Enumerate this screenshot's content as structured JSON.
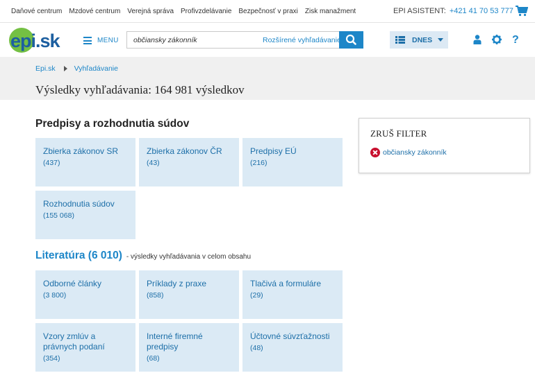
{
  "topnav": [
    "Daňové centrum",
    "Mzdové centrum",
    "Verejná správa",
    "Profivzdelávanie",
    "Bezpečnosť v praxi",
    "Zisk manažment"
  ],
  "assistant": {
    "label": "EPI ASISTENT:",
    "phone": "+421 41 70 53 777"
  },
  "header": {
    "logo_text": "epi.sk",
    "menu_label": "MENU",
    "search_value": "občiansky zákonník",
    "advanced_label": "Rozšírené vyhľadávanie",
    "dnes_label": "DNES"
  },
  "icons": {
    "cart": "cart-icon",
    "search": "search-icon",
    "user": "user-icon",
    "settings": "gear-icon",
    "help": "help-icon",
    "grid": "grid-icon",
    "remove": "remove-filter-icon"
  },
  "colors": {
    "accent": "#1d86c8",
    "tile_bg": "#dbeaf5",
    "remove": "#c8102e"
  },
  "breadcrumb": [
    "Epi.sk",
    "Vyhľadávanie"
  ],
  "page_title": "Výsledky vyhľadávania: 164 981 výsledkov",
  "sections": {
    "predpisy": {
      "title": "Predpisy a rozhodnutia súdov",
      "tiles": [
        {
          "name": "Zbierka zákonov SR",
          "count": "(437)"
        },
        {
          "name": "Zbierka zákonov ČR",
          "count": "(43)"
        },
        {
          "name": "Predpisy EÚ",
          "count": "(216)"
        },
        {
          "name": "Rozhodnutia súdov",
          "count": "(155 068)"
        }
      ]
    },
    "literatura": {
      "title": "Literatúra (6 010)",
      "subtitle": "- výsledky vyhľadávania v celom obsahu",
      "tiles": [
        {
          "name": "Odborné články",
          "count": "(3 800)"
        },
        {
          "name": "Príklady z praxe",
          "count": "(858)"
        },
        {
          "name": "Tlačivá a formuláre",
          "count": "(29)"
        },
        {
          "name": "Vzory zmlúv a právnych podaní",
          "count": "(354)"
        },
        {
          "name": "Interné firemné predpisy",
          "count": "(68)"
        },
        {
          "name": "Účtovné súvzťažnosti",
          "count": "(48)"
        }
      ]
    }
  },
  "filter": {
    "title": "ZRUŠ FILTER",
    "active": "občiansky zákonník"
  }
}
